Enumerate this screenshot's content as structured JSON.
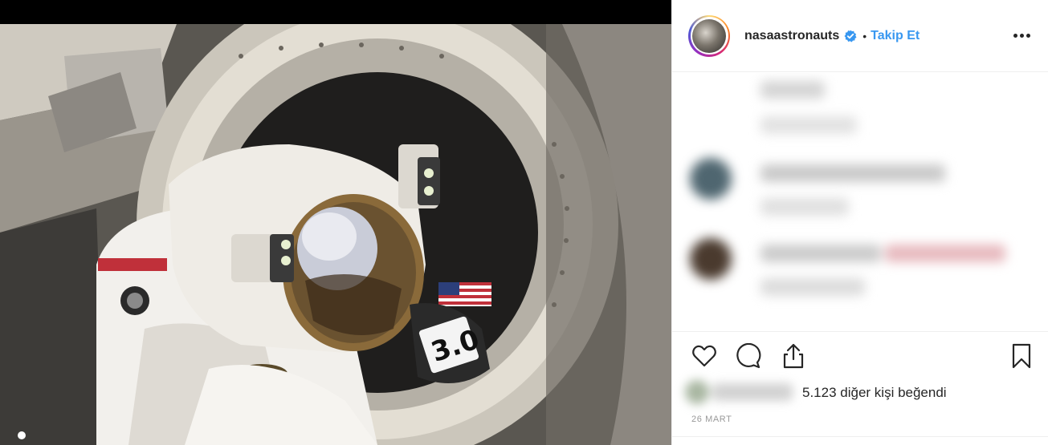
{
  "post": {
    "image_alt": "",
    "author": {
      "username": "nasaastronauts",
      "verified": true,
      "separator": "•",
      "follow_label": "Takip Et",
      "avatar_icon": "avatar-astronaut"
    },
    "likes_text": "5.123 diğer kişi beğendi",
    "date": "26 MART"
  },
  "icons": {
    "verified": "verified-badge-icon",
    "more": "more-options-icon",
    "like": "heart-icon",
    "comment": "comment-bubble-icon",
    "share": "share-icon",
    "save": "bookmark-icon"
  },
  "colors": {
    "link": "#3897f0",
    "verified": "#3897f0",
    "text": "#262626",
    "muted": "#999999",
    "border": "#efefef"
  }
}
